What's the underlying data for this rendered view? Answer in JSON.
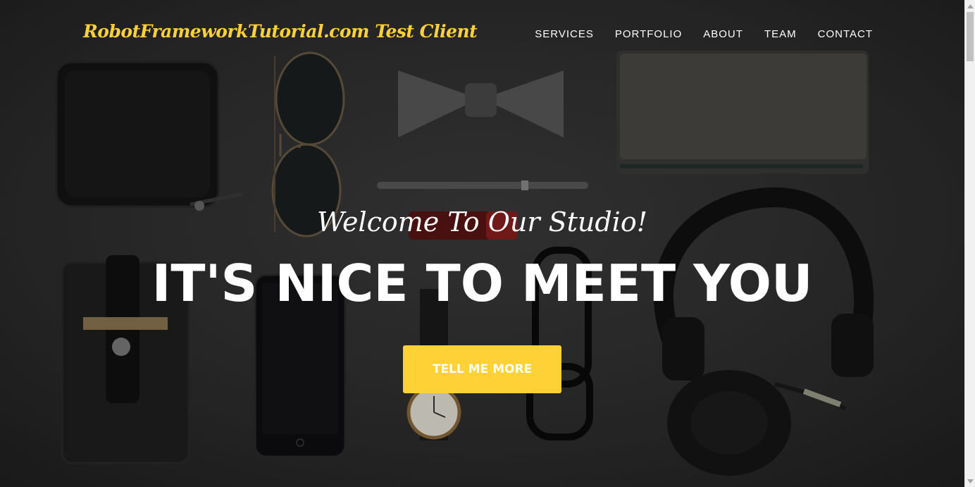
{
  "navbar": {
    "brand": "RobotFrameworkTutorial.com Test Client",
    "links": [
      "SERVICES",
      "PORTFOLIO",
      "ABOUT",
      "TEAM",
      "CONTACT"
    ]
  },
  "hero": {
    "lead_in": "Welcome To Our Studio!",
    "heading": "IT'S NICE TO MEET YOU",
    "cta_label": "TELL ME MORE",
    "background_icon": "flat-lay-accessories-photo"
  },
  "colors": {
    "accent": "#fed136",
    "text": "#ffffff",
    "background": "#2b2b2b"
  }
}
